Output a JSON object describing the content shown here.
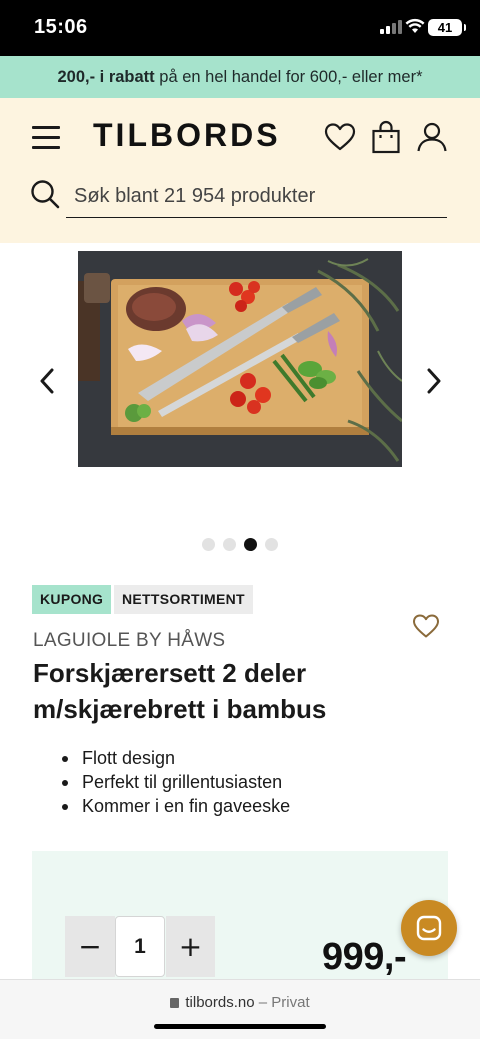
{
  "status_bar": {
    "time": "15:06",
    "battery": "41"
  },
  "promo": {
    "bold": "200,- i rabatt",
    "rest": " på en hel handel for 600,- eller mer*"
  },
  "header": {
    "logo": "TILBORDS",
    "search_placeholder": "Søk blant 21 954 produkter"
  },
  "gallery": {
    "image_count": 4,
    "active_index": 2
  },
  "product": {
    "badges": [
      "KUPONG",
      "NETTSORTIMENT"
    ],
    "brand": "LAGUIOLE BY HÅWS",
    "title": "Forskjærersett 2 deler m/skjærebrett i bambus",
    "features": [
      "Flott design",
      "Perfekt til grillentusiasten",
      "Kommer i en fin gaveeske"
    ]
  },
  "purchase": {
    "minus_label": "−",
    "quantity": "1",
    "plus_label": "+",
    "price": "999,-"
  },
  "browser": {
    "domain": "tilbords.no",
    "separator": " – ",
    "mode": "Privat"
  },
  "colors": {
    "promo_bg": "#a6e3cc",
    "header_bg": "#fdf4e0",
    "buy_panel_bg": "#edf8f3",
    "chat_button": "#c98a23"
  }
}
